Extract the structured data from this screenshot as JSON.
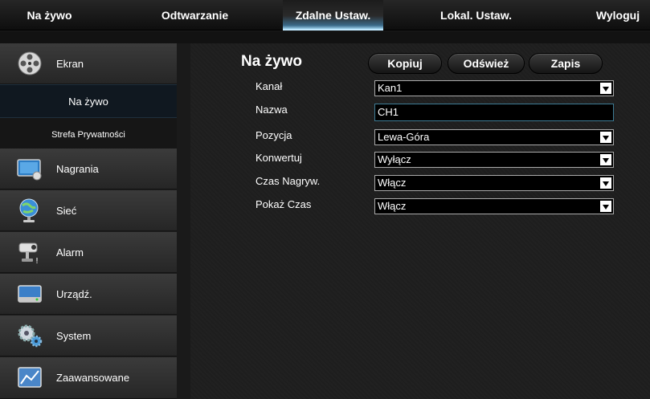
{
  "topnav": {
    "items": [
      {
        "label": "Na żywo"
      },
      {
        "label": "Odtwarzanie"
      },
      {
        "label": "Zdalne Ustaw."
      },
      {
        "label": "Lokal. Ustaw."
      },
      {
        "label": "Wyloguj"
      }
    ],
    "active_index": 2
  },
  "sidebar": {
    "items": [
      {
        "label": "Ekran",
        "icon": "film-reel-icon"
      },
      {
        "label": "Na żywo"
      },
      {
        "label": "Strefa Prywatności"
      },
      {
        "label": "Nagrania",
        "icon": "monitor-icon"
      },
      {
        "label": "Sieć",
        "icon": "globe-icon"
      },
      {
        "label": "Alarm",
        "icon": "camera-icon"
      },
      {
        "label": "Urządź.",
        "icon": "hard-drive-icon"
      },
      {
        "label": "System",
        "icon": "gears-icon"
      },
      {
        "label": "Zaawansowane",
        "icon": "chart-icon"
      }
    ],
    "active_sub": "Na żywo"
  },
  "main": {
    "title": "Na żywo",
    "buttons": {
      "copy": "Kopiuj",
      "refresh": "Odśwież",
      "save": "Zapis"
    },
    "fields": [
      {
        "label": "Kanał",
        "value": "Kan1",
        "type": "select"
      },
      {
        "label": "Nazwa",
        "value": "CH1",
        "type": "text"
      },
      {
        "label": "Pozycja",
        "value": "Lewa-Góra",
        "type": "select"
      },
      {
        "label": "Konwertuj",
        "value": "Wyłącz",
        "type": "select"
      },
      {
        "label": "Czas Nagryw.",
        "value": "Włącz",
        "type": "select"
      },
      {
        "label": "Pokaż Czas",
        "value": "Włącz",
        "type": "select"
      }
    ]
  },
  "colors": {
    "accent": "#9fd3ee",
    "text_field_border": "#3e7c95",
    "background": "#1e1e1e"
  }
}
